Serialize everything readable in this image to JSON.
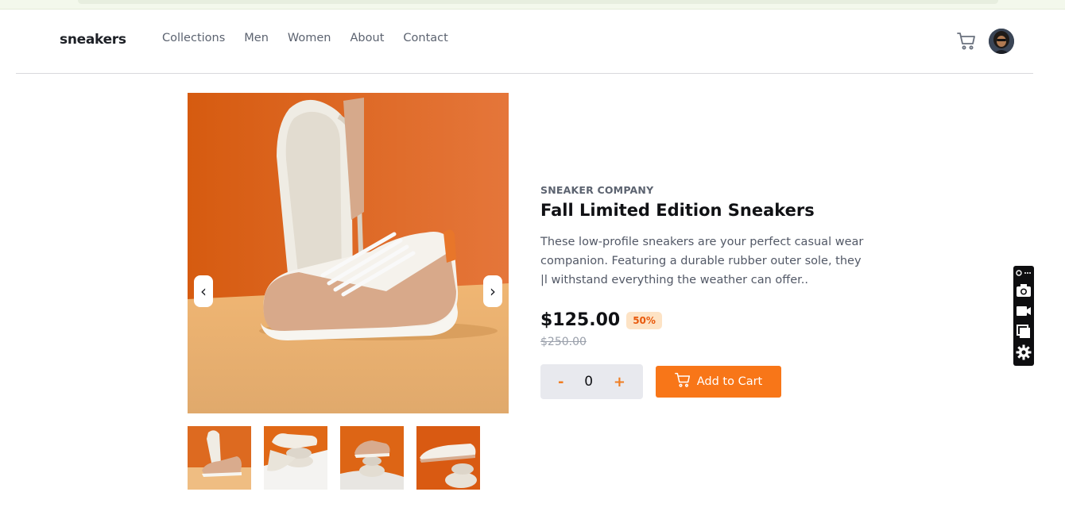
{
  "header": {
    "logo": "sneakers",
    "nav": [
      "Collections",
      "Men",
      "Women",
      "About",
      "Contact"
    ]
  },
  "product": {
    "company": "SNEAKER COMPANY",
    "title": "Fall Limited Edition Sneakers",
    "description": "These low-profile sneakers are your perfect casual wear companion. Featuring a durable rubber outer sole, they |l withstand everything the weather can offer..",
    "price": "$125.00",
    "discount": "50%",
    "original_price": "$250.00"
  },
  "quantity": {
    "minus": "-",
    "value": "0",
    "plus": "+"
  },
  "add_to_cart_label": "Add to Cart",
  "gallery": {
    "prev": "‹",
    "next": "›",
    "thumbnail_count": 4
  },
  "colors": {
    "accent": "#f87618",
    "badge_bg": "#fde3c5",
    "photo_orange": "#e0601a",
    "photo_floor": "#e8b579"
  },
  "icons": [
    "cart-icon",
    "avatar",
    "chevron-left-icon",
    "chevron-right-icon",
    "camera-icon",
    "video-icon",
    "copy-icon",
    "gear-icon",
    "link-icon",
    "more-icon"
  ]
}
